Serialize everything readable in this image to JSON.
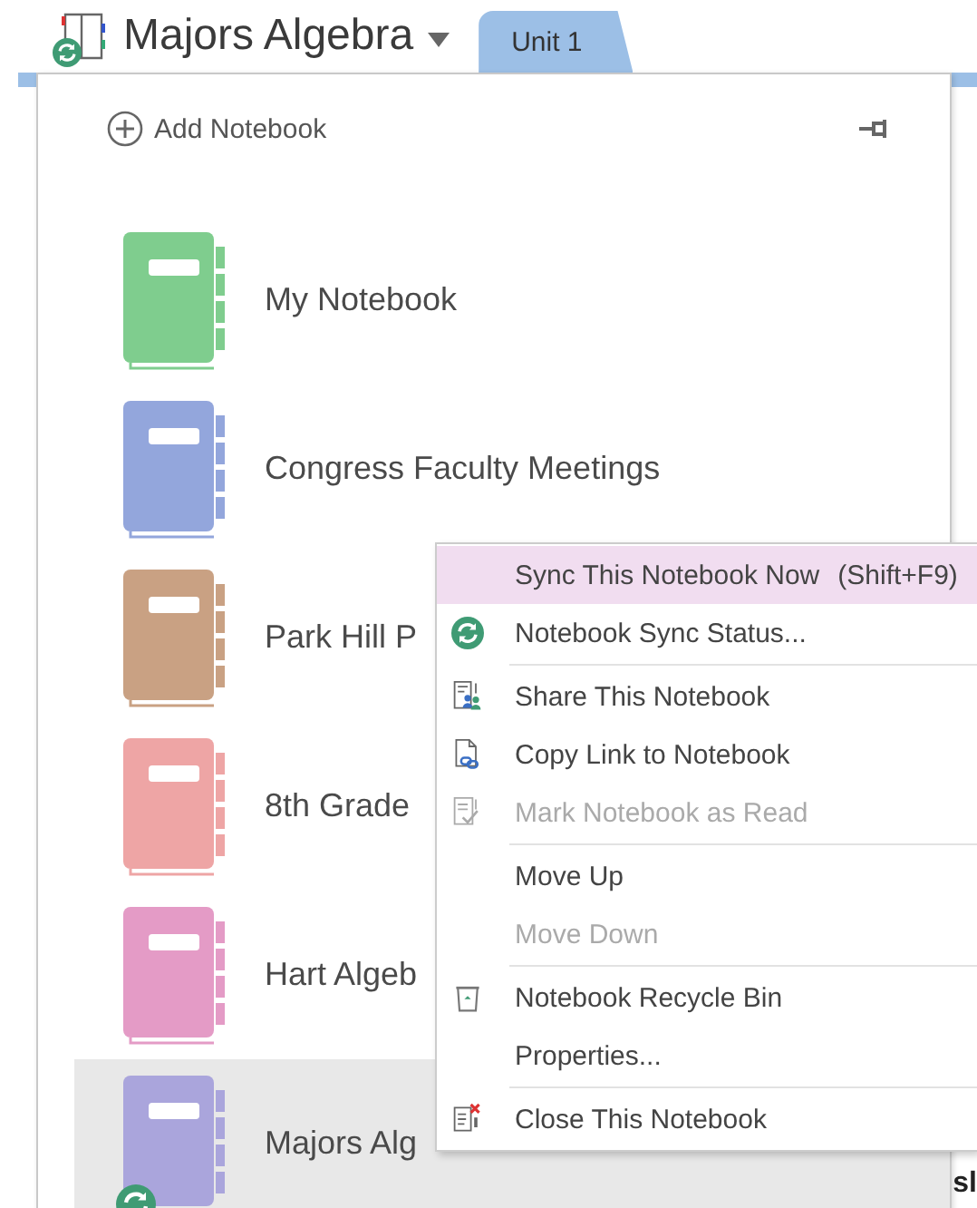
{
  "header": {
    "notebook_title": "Majors Algebra",
    "tabs": [
      {
        "label": "Unit 1",
        "selected": true
      }
    ]
  },
  "notebook_panel": {
    "add_label": "Add Notebook",
    "notebooks": [
      {
        "name": "My Notebook",
        "color": "#7fcd8e",
        "selected": false,
        "syncing": false
      },
      {
        "name": "Congress Faculty Meetings",
        "color": "#93a6dc",
        "selected": false,
        "syncing": false
      },
      {
        "name": "Park Hill P",
        "color": "#c9a183",
        "selected": false,
        "syncing": false
      },
      {
        "name": "8th Grade",
        "color": "#eea5a5",
        "selected": false,
        "syncing": false
      },
      {
        "name": "Hart Algeb",
        "color": "#e49bc6",
        "selected": false,
        "syncing": false
      },
      {
        "name": "Majors Alg",
        "color": "#aaa5dc",
        "selected": true,
        "syncing": true
      }
    ]
  },
  "context_menu": [
    {
      "label": "Sync This Notebook Now",
      "shortcut": "(Shift+F9)",
      "selected": true,
      "disabled": false,
      "separator_after": false
    },
    {
      "label": "Notebook Sync Status...",
      "selected": false,
      "disabled": false,
      "separator_after": true
    },
    {
      "label": "Share This Notebook",
      "selected": false,
      "disabled": false,
      "separator_after": false
    },
    {
      "label": "Copy Link to Notebook",
      "selected": false,
      "disabled": false,
      "separator_after": false
    },
    {
      "label": "Mark Notebook as Read",
      "selected": false,
      "disabled": true,
      "separator_after": true
    },
    {
      "label": "Move Up",
      "selected": false,
      "disabled": false,
      "separator_after": false
    },
    {
      "label": "Move Down",
      "selected": false,
      "disabled": true,
      "separator_after": true
    },
    {
      "label": "Notebook Recycle Bin",
      "selected": false,
      "disabled": false,
      "separator_after": false
    },
    {
      "label": "Properties...",
      "selected": false,
      "disabled": false,
      "separator_after": true
    },
    {
      "label": "Close This Notebook",
      "selected": false,
      "disabled": false,
      "separator_after": false
    }
  ],
  "page_fragment": "sl"
}
